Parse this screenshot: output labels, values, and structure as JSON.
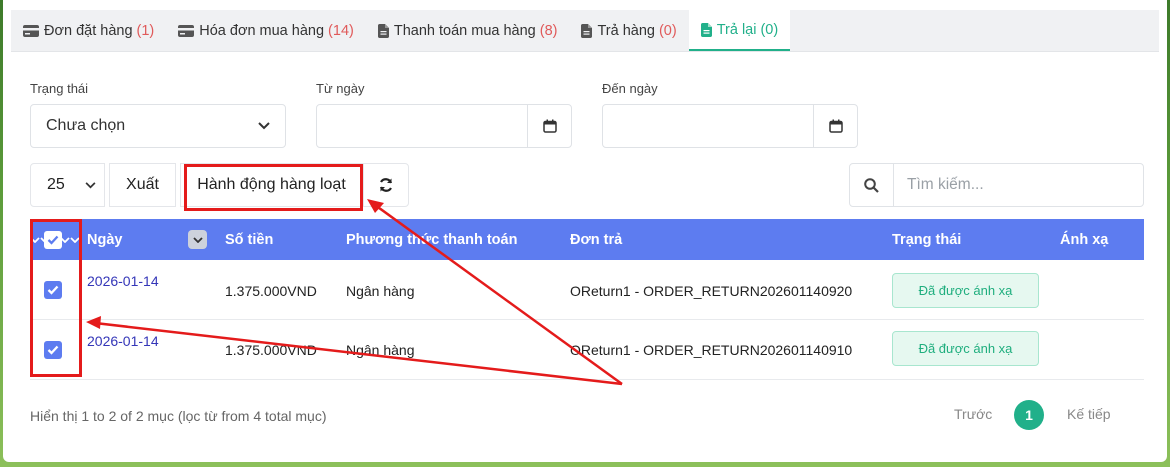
{
  "tabs": [
    {
      "label": "Đơn đặt hàng",
      "count": "(1)",
      "icon": "credit-card-icon"
    },
    {
      "label": "Hóa đơn mua hàng",
      "count": "(14)",
      "icon": "credit-card-icon"
    },
    {
      "label": "Thanh toán mua hàng",
      "count": "(8)",
      "icon": "file-icon"
    },
    {
      "label": "Trả hàng",
      "count": "(0)",
      "icon": "file-icon"
    },
    {
      "label": "Trả lại",
      "count": "(0)",
      "icon": "file-icon",
      "active": true
    }
  ],
  "filters": {
    "status_label": "Trạng thái",
    "status_value": "Chưa chọn",
    "from_label": "Từ ngày",
    "to_label": "Đến ngày"
  },
  "toolbar": {
    "page_size": "25",
    "export_label": "Xuất",
    "bulk_label": "Hành động hàng loạt",
    "search_placeholder": "Tìm kiếm..."
  },
  "table": {
    "columns": [
      "Ngày",
      "Số tiền",
      "Phương thức thanh toán",
      "Đơn trả",
      "Trạng thái",
      "Ánh xạ"
    ],
    "rows": [
      {
        "date": "2026-01-14",
        "amount": "1.375.000VND",
        "method": "Ngân hàng",
        "order": "OReturn1 - ORDER_RETURN202601140920",
        "status": "Đã được ánh xạ",
        "checked": true
      },
      {
        "date": "2026-01-14",
        "amount": "1.375.000VND",
        "method": "Ngân hàng",
        "order": "OReturn1 - ORDER_RETURN202601140910",
        "status": "Đã được ánh xạ",
        "checked": true
      }
    ]
  },
  "footer": {
    "info": "Hiển thị 1 to 2 of 2 mục (lọc từ from 4 total mục)",
    "prev": "Trước",
    "page": "1",
    "next": "Kế tiếp"
  },
  "colors": {
    "accent": "#21b08a",
    "header": "#5d7cf0",
    "annotation": "#e41b1b"
  }
}
